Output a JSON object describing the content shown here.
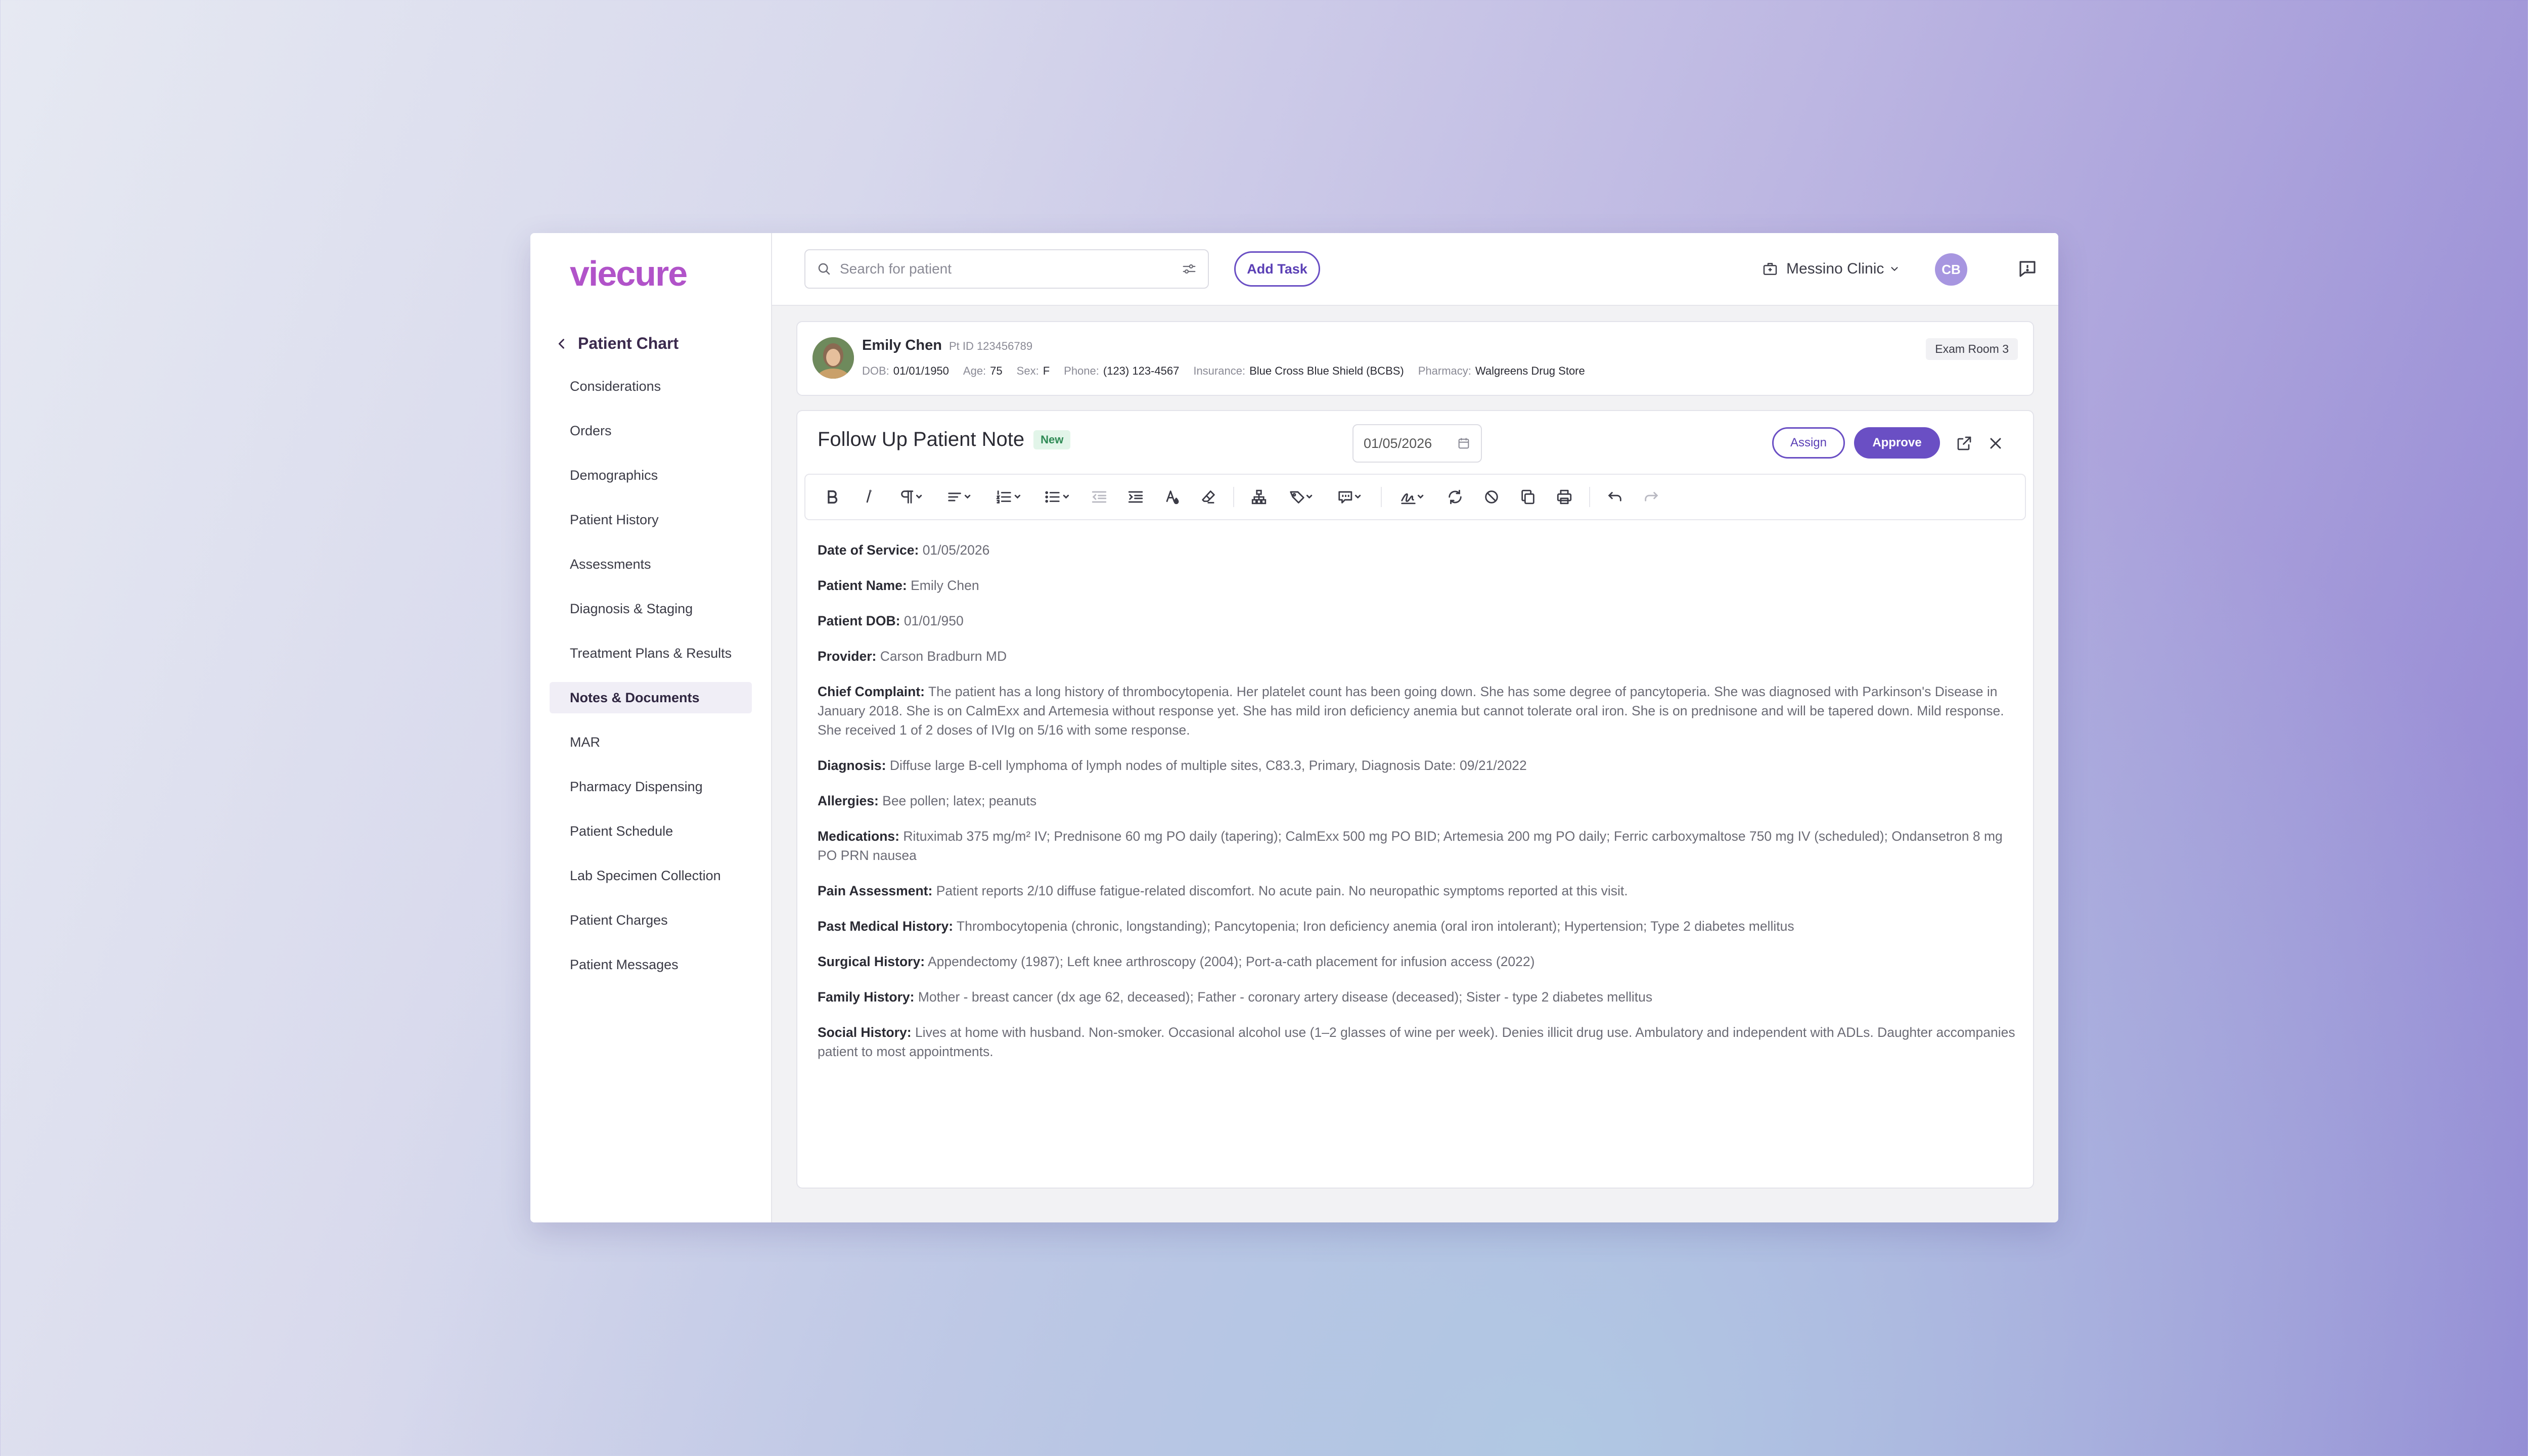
{
  "app": {
    "logo": "viecure"
  },
  "sidebar": {
    "back_label": "Patient Chart",
    "items": [
      {
        "label": "Considerations"
      },
      {
        "label": "Orders"
      },
      {
        "label": "Demographics"
      },
      {
        "label": "Patient History"
      },
      {
        "label": "Assessments"
      },
      {
        "label": "Diagnosis & Staging"
      },
      {
        "label": "Treatment Plans & Results"
      },
      {
        "label": "Notes & Documents",
        "active": true
      },
      {
        "label": "MAR"
      },
      {
        "label": "Pharmacy Dispensing"
      },
      {
        "label": "Patient Schedule"
      },
      {
        "label": "Lab Specimen Collection"
      },
      {
        "label": "Patient Charges"
      },
      {
        "label": "Patient Messages"
      }
    ]
  },
  "topbar": {
    "search_placeholder": "Search for patient",
    "add_task_label": "Add Task",
    "clinic_name": "Messino Clinic",
    "user_initials": "CB"
  },
  "patient": {
    "name": "Emily Chen",
    "pt_id": "Pt ID 123456789",
    "dob_label": "DOB:",
    "dob": "01/01/1950",
    "age_label": "Age:",
    "age": "75",
    "sex_label": "Sex:",
    "sex": "F",
    "phone_label": "Phone:",
    "phone": "(123) 123-4567",
    "insurance_label": "Insurance:",
    "insurance": "Blue Cross Blue Shield (BCBS)",
    "pharmacy_label": "Pharmacy:",
    "pharmacy": "Walgreens Drug Store",
    "room": "Exam Room 3"
  },
  "note": {
    "title": "Follow Up Patient Note",
    "status_badge": "New",
    "date": "01/05/2026",
    "assign_label": "Assign",
    "approve_label": "Approve",
    "sections": [
      {
        "label": "Date of Service:",
        "text": "01/05/2026"
      },
      {
        "label": "Patient Name:",
        "text": "Emily Chen"
      },
      {
        "label": "Patient DOB:",
        "text": "01/01/950"
      },
      {
        "label": "Provider:",
        "text": "Carson Bradburn MD"
      },
      {
        "label": "Chief Complaint:",
        "text": "The patient has a long history of thrombocytopenia. Her platelet count has been going down. She has some degree of pancytoperia. She was diagnosed with Parkinson's Disease in January 2018. She is on CalmExx and Artemesia without response yet. She has mild iron deficiency anemia but cannot tolerate oral iron. She is on prednisone and will be tapered down. Mild response. She received 1 of 2 doses of IVIg on 5/16 with some response."
      },
      {
        "label": "Diagnosis:",
        "text": "Diffuse large B-cell lymphoma of lymph nodes of multiple sites, C83.3, Primary, Diagnosis Date: 09/21/2022"
      },
      {
        "label": "Allergies:",
        "text": "Bee pollen; latex; peanuts"
      },
      {
        "label": "Medications:",
        "text": "Rituximab 375 mg/m² IV; Prednisone 60 mg PO daily (tapering); CalmExx 500 mg PO BID; Artemesia 200 mg PO daily; Ferric carboxymaltose 750 mg IV (scheduled); Ondansetron 8 mg PO PRN nausea"
      },
      {
        "label": "Pain Assessment:",
        "text": "Patient reports 2/10 diffuse fatigue-related discomfort. No acute pain. No neuropathic symptoms reported at this visit."
      },
      {
        "label": "Past Medical History:",
        "text": "Thrombocytopenia (chronic, longstanding); Pancytopenia; Iron deficiency anemia (oral iron intolerant); Hypertension; Type 2 diabetes mellitus"
      },
      {
        "label": "Surgical History:",
        "text": "Appendectomy (1987); Left knee arthroscopy (2004); Port-a-cath placement for infusion access (2022)"
      },
      {
        "label": "Family History:",
        "text": "Mother - breast cancer (dx age 62, deceased); Father - coronary artery disease (deceased); Sister - type 2 diabetes mellitus"
      },
      {
        "label": "Social History:",
        "text": "Lives at home with husband. Non-smoker. Occasional alcohol use (1–2 glasses of wine per week). Denies illicit drug use. Ambulatory and independent with ADLs. Daughter accompanies patient to most appointments."
      }
    ]
  },
  "colors": {
    "brand": "#b153c9",
    "accent": "#6a4fc4",
    "new_badge_bg": "#e2f5e9",
    "new_badge_text": "#2f8a55"
  }
}
